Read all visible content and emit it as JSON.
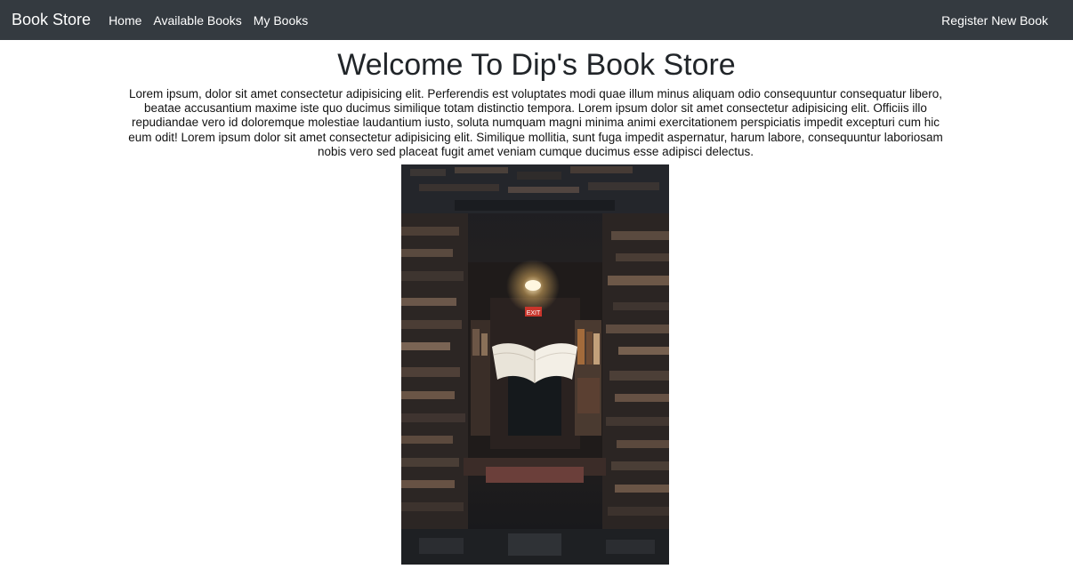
{
  "navbar": {
    "brand": "Book Store",
    "links": [
      {
        "label": "Home"
      },
      {
        "label": "Available Books"
      },
      {
        "label": "My Books"
      }
    ],
    "right_link": "Register New Book"
  },
  "main": {
    "title": "Welcome To Dip's Book Store",
    "intro": "Lorem ipsum, dolor sit amet consectetur adipisicing elit. Perferendis est voluptates modi quae illum minus aliquam odio consequuntur consequatur libero, beatae accusantium maxime iste quo ducimus similique totam distinctio tempora. Lorem ipsum dolor sit amet consectetur adipisicing elit. Officiis illo repudiandae vero id doloremque molestiae laudantium iusto, soluta numquam magni minima animi exercitationem perspiciatis impedit excepturi cum hic eum odit! Lorem ipsum dolor sit amet consectetur adipisicing elit. Similique mollitia, sunt fuga impedit aspernatur, harum labore, consequuntur laboriosam nobis vero sed placeat fugit amet veniam cumque ducimus esse adipisci delectus.",
    "hero_image": {
      "subject": "floating open book in a dark bookstore tunnel of stacked books",
      "exit_sign": "EXIT"
    }
  },
  "colors": {
    "navbar_bg": "#343a40",
    "navbar_text": "#ffffff",
    "page_bg": "#ffffff"
  }
}
